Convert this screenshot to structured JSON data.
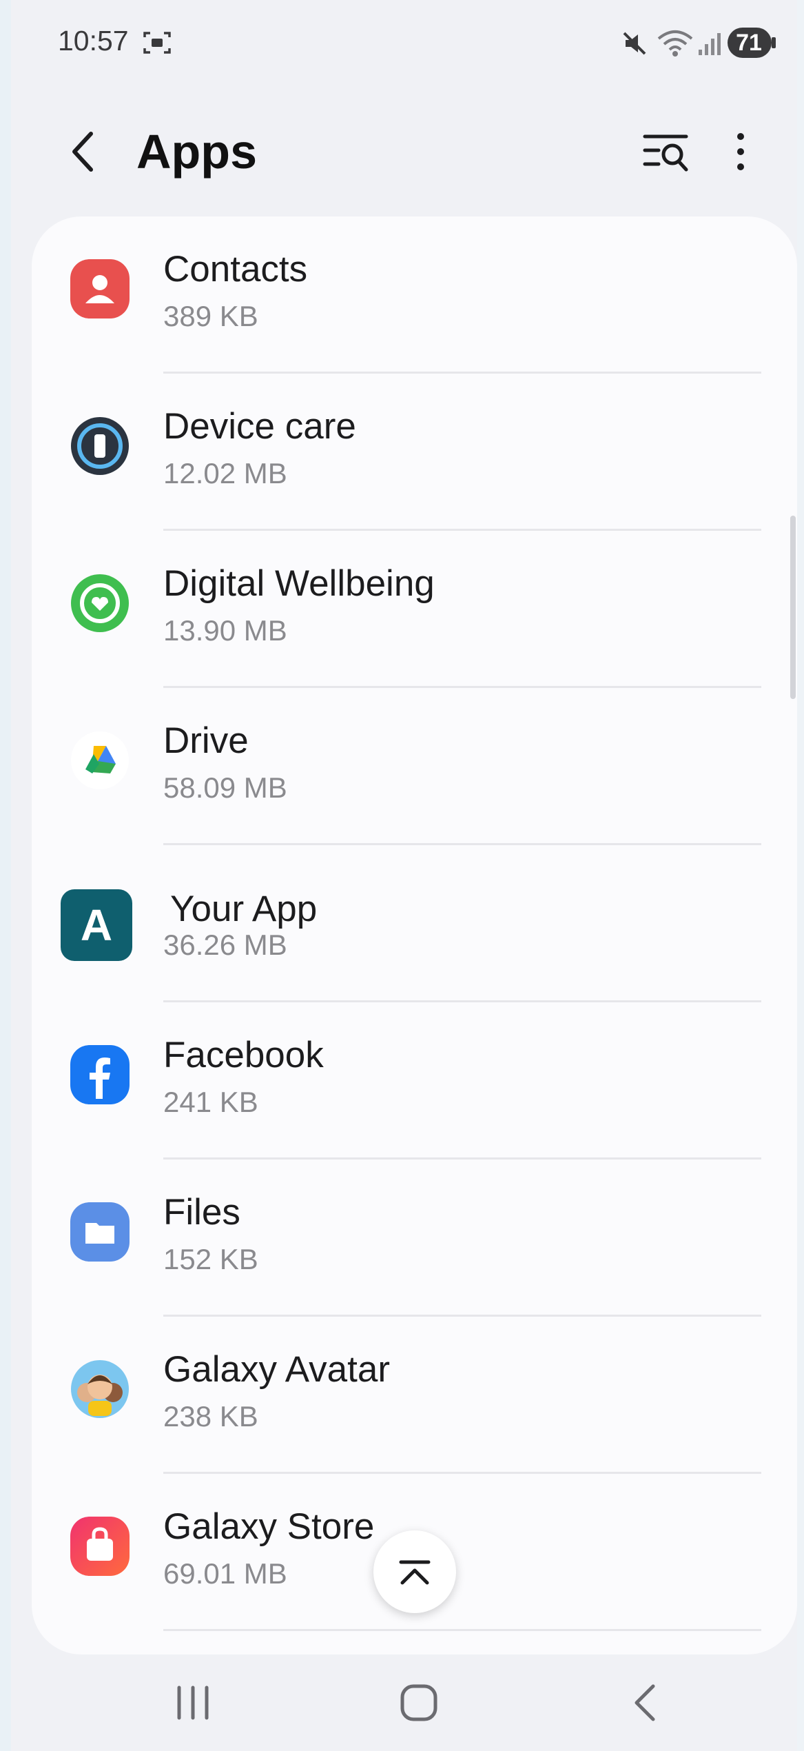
{
  "status_bar": {
    "time": "10:57",
    "battery": "71",
    "icons": [
      "screenshot-icon",
      "mute-icon",
      "wifi-icon",
      "signal-icon",
      "battery-icon"
    ]
  },
  "header": {
    "title": "Apps",
    "back_icon": "chevron-left-icon",
    "search_icon": "filter-search-icon",
    "more_icon": "more-vertical-icon"
  },
  "apps": [
    {
      "name": "Contacts",
      "size": "389 KB",
      "icon": "contacts-icon"
    },
    {
      "name": "Device care",
      "size": "12.02 MB",
      "icon": "device-care-icon"
    },
    {
      "name": "Digital Wellbeing",
      "size": "13.90 MB",
      "icon": "digital-wellbeing-icon"
    },
    {
      "name": "Drive",
      "size": "58.09 MB",
      "icon": "drive-icon"
    },
    {
      "name": "Your App",
      "size": "36.26 MB",
      "icon": "your-app-icon",
      "icon_letter": "A"
    },
    {
      "name": "Facebook",
      "size": "241 KB",
      "icon": "facebook-icon"
    },
    {
      "name": "Files",
      "size": "152 KB",
      "icon": "files-icon"
    },
    {
      "name": "Galaxy Avatar",
      "size": "238 KB",
      "icon": "galaxy-avatar-icon"
    },
    {
      "name": "Galaxy Store",
      "size": "69.01 MB",
      "icon": "galaxy-store-icon"
    }
  ],
  "colors": {
    "background": "#f0f1f5",
    "card": "#fbfbfd",
    "contacts": "#e8504e",
    "device_care": "#2b3440",
    "wellbeing": "#3fbe4f",
    "your_app": "#0f5f6e",
    "facebook": "#1877f2",
    "files": "#5b8fe6",
    "galaxy_store": "#f0336f"
  },
  "nav_bar": {
    "items": [
      "recents-icon",
      "home-icon",
      "back-icon"
    ]
  }
}
